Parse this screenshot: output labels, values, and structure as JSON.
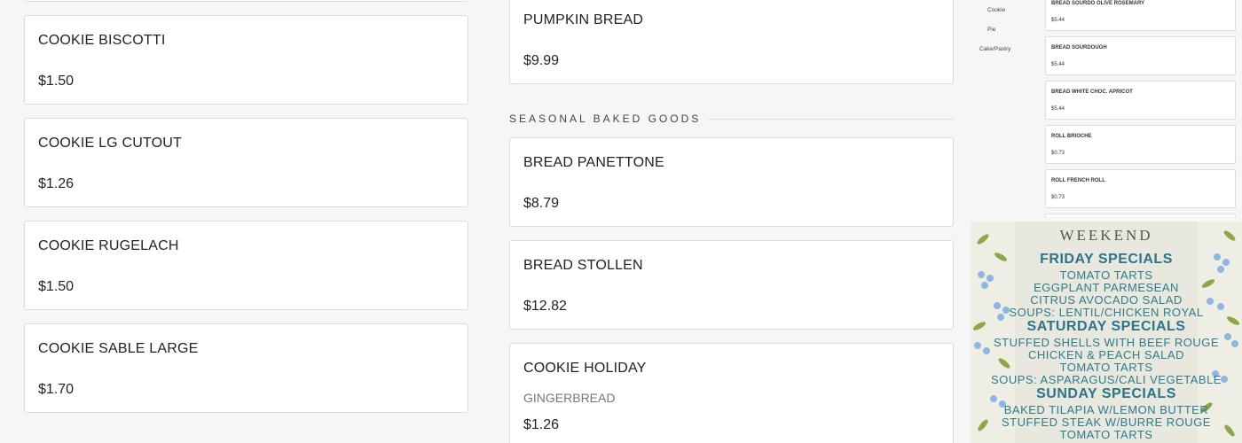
{
  "left_column": {
    "items": [
      {
        "name": "COOKIE BISCOTTI",
        "price": "$1.50"
      },
      {
        "name": "COOKIE LG CUTOUT",
        "price": "$1.26"
      },
      {
        "name": "COOKIE RUGELACH",
        "price": "$1.50"
      },
      {
        "name": "COOKIE SABLE LARGE",
        "price": "$1.70"
      }
    ]
  },
  "middle_column": {
    "top_item": {
      "name": "PUMPKIN BREAD",
      "price": "$9.99"
    },
    "section_title": "SEASONAL BAKED GOODS",
    "items": [
      {
        "name": "BREAD PANETTONE",
        "price": "$8.79"
      },
      {
        "name": "BREAD STOLLEN",
        "price": "$12.82"
      },
      {
        "name": "COOKIE HOLIDAY",
        "description": "GINGERBREAD",
        "price": "$1.26"
      }
    ]
  },
  "mini_menu": {
    "categories": [
      "Cookie",
      "Pie",
      "Cake/Pastry"
    ],
    "items": [
      {
        "name": "BREAD SOURDO OLIVE ROSEMARY",
        "price": "$5.44"
      },
      {
        "name": "BREAD SOURDOUGH",
        "price": "$5.44"
      },
      {
        "name": "BREAD WHITE CHOC. APRICOT",
        "price": "$5.44"
      },
      {
        "name": "ROLL BRIOCHE",
        "price": "$0.73"
      },
      {
        "name": "ROLL FRENCH ROLL",
        "price": "$0.73"
      }
    ]
  },
  "poster": {
    "title": "WEEKEND",
    "lines": [
      {
        "text": "FRIDAY SPECIALS",
        "kind": "head"
      },
      {
        "text": "TOMATO TARTS",
        "kind": "item"
      },
      {
        "text": "EGGPLANT PARMESEAN",
        "kind": "item"
      },
      {
        "text": "CITRUS AVOCADO SALAD",
        "kind": "item"
      },
      {
        "text": "SOUPS: LENTIL/CHICKEN ROYAL",
        "kind": "item"
      },
      {
        "text": "SATURDAY SPECIALS",
        "kind": "head"
      },
      {
        "text": "STUFFED SHELLS WITH BEEF ROUGE",
        "kind": "item"
      },
      {
        "text": "CHICKEN & PEACH SALAD",
        "kind": "item"
      },
      {
        "text": "TOMATO TARTS",
        "kind": "item"
      },
      {
        "text": "SOUPS: ASPARAGUS/CALI VEGETABLE",
        "kind": "item"
      },
      {
        "text": "SUNDAY SPECIALS",
        "kind": "head"
      },
      {
        "text": "BAKED TILAPIA W/LEMON BUTTER",
        "kind": "item"
      },
      {
        "text": "STUFFED STEAK W/BURRE ROUGE",
        "kind": "item"
      },
      {
        "text": "TOMATO TARTS",
        "kind": "item"
      }
    ]
  },
  "colors": {
    "poster_text": "#2f7a8e",
    "flower_blue": "#8fb6e0",
    "leaf_green": "#8aa84a"
  }
}
